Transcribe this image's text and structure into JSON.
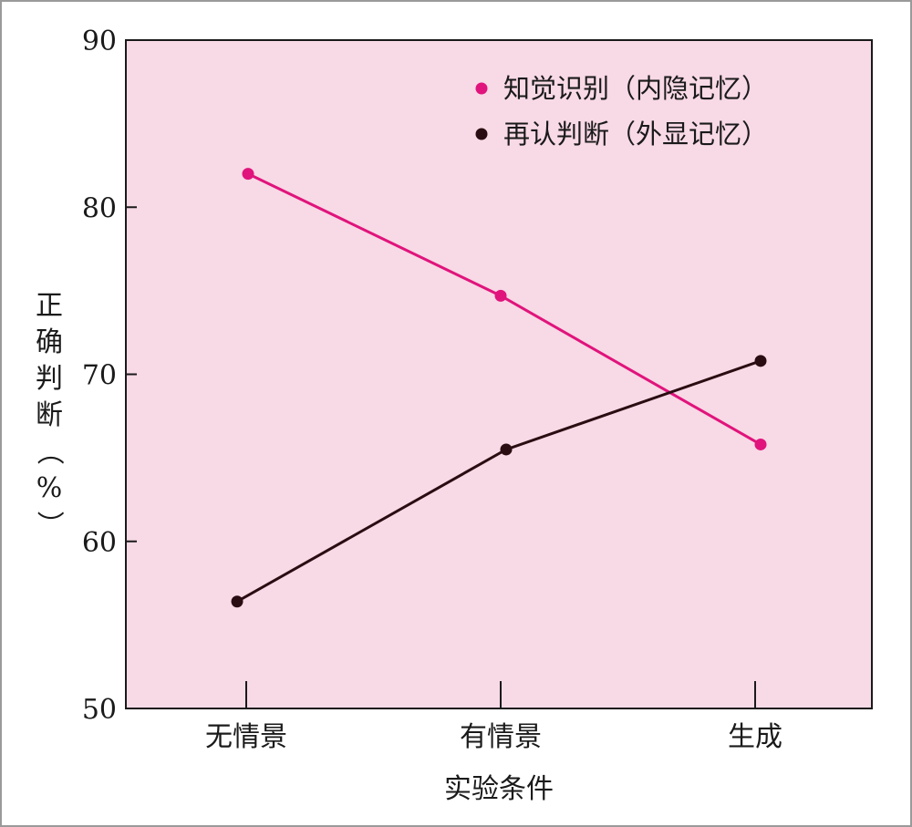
{
  "chart_data": {
    "type": "line",
    "categories": [
      "无情景",
      "有情景",
      "生成"
    ],
    "xlabel": "实验条件",
    "ylabel": "正确判断（%）",
    "ylim": [
      50,
      90
    ],
    "yticks": [
      50,
      60,
      70,
      80,
      90
    ],
    "grid": false,
    "legend_position": "top-right",
    "background_color": "#f8d9e6",
    "series": [
      {
        "name": "知觉识别（内隐记忆）",
        "color": "#e0147c",
        "values": [
          82,
          74.7,
          65.8
        ]
      },
      {
        "name": "再认判断（外显记忆）",
        "color": "#2a0d12",
        "values": [
          56.4,
          65.5,
          70.8
        ]
      }
    ]
  }
}
